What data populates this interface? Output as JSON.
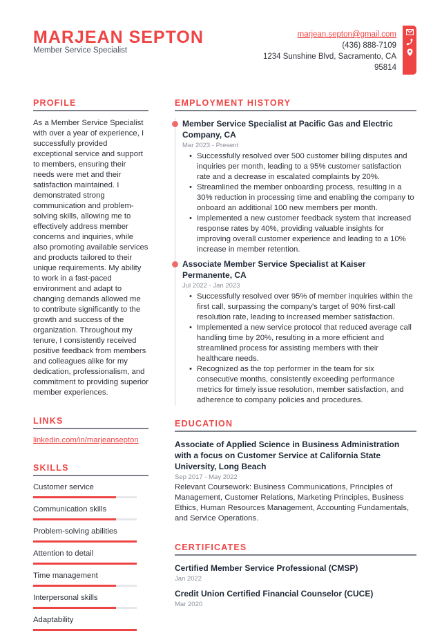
{
  "header": {
    "name": "MARJEAN SEPTON",
    "title": "Member Service Specialist",
    "email": "marjean.septon@gmail.com",
    "phone": "(436) 888-7109",
    "address_line1": "1234 Sunshine Blvd, Sacramento, CA",
    "address_line2": "95814",
    "icons": [
      "envelope-icon",
      "phone-icon",
      "map-pin-icon"
    ]
  },
  "accent_color": "#ef4444",
  "profile": {
    "heading": "PROFILE",
    "text": "As a Member Service Specialist with over a year of experience, I successfully provided exceptional service and support to members, ensuring their needs were met and their satisfaction maintained. I demonstrated strong communication and problem-solving skills, allowing me to effectively address member concerns and inquiries, while also promoting available services and products tailored to their unique requirements. My ability to work in a fast-paced environment and adapt to changing demands allowed me to contribute significantly to the growth and success of the organization. Throughout my tenure, I consistently received positive feedback from members and colleagues alike for my dedication, professionalism, and commitment to providing superior member experiences."
  },
  "links": {
    "heading": "LINKS",
    "items": [
      "linkedin.com/in/marjeansepton"
    ]
  },
  "skills": {
    "heading": "SKILLS",
    "items": [
      {
        "name": "Customer service",
        "level": 0.8
      },
      {
        "name": "Communication skills",
        "level": 0.8
      },
      {
        "name": "Problem-solving abilities",
        "level": 1.0
      },
      {
        "name": "Attention to detail",
        "level": 1.0
      },
      {
        "name": "Time management",
        "level": 0.8
      },
      {
        "name": "Interpersonal skills",
        "level": 0.8
      },
      {
        "name": "Adaptability",
        "level": 1.0
      }
    ]
  },
  "employment": {
    "heading": "EMPLOYMENT HISTORY",
    "jobs": [
      {
        "title": "Member Service Specialist at Pacific Gas and Electric Company, CA",
        "date": "Mar 2023 - Present",
        "bullets": [
          "Successfully resolved over 500 customer billing disputes and inquiries per month, leading to a 95% customer satisfaction rate and a decrease in escalated complaints by 20%.",
          "Streamlined the member onboarding process, resulting in a 30% reduction in processing time and enabling the company to onboard an additional 100 new members per month.",
          "Implemented a new customer feedback system that increased response rates by 40%, providing valuable insights for improving overall customer experience and leading to a 10% increase in member retention."
        ]
      },
      {
        "title": "Associate Member Service Specialist at Kaiser Permanente, CA",
        "date": "Jul 2022 - Jan 2023",
        "bullets": [
          "Successfully resolved over 95% of member inquiries within the first call, surpassing the company's target of 90% first-call resolution rate, leading to increased member satisfaction.",
          "Implemented a new service protocol that reduced average call handling time by 20%, resulting in a more efficient and streamlined process for assisting members with their healthcare needs.",
          "Recognized as the top performer in the team for six consecutive months, consistently exceeding performance metrics for timely issue resolution, member satisfaction, and adherence to company policies and procedures."
        ]
      }
    ]
  },
  "education": {
    "heading": "EDUCATION",
    "items": [
      {
        "title": "Associate of Applied Science in Business Administration with a focus on Customer Service at California State University, Long Beach",
        "date": "Sep 2017 - May 2022",
        "description": "Relevant Coursework: Business Communications, Principles of Management, Customer Relations, Marketing Principles, Business Ethics, Human Resources Management, Accounting Fundamentals, and Service Operations."
      }
    ]
  },
  "certificates": {
    "heading": "CERTIFICATES",
    "items": [
      {
        "title": "Certified Member Service Professional (CMSP)",
        "date": "Jan 2022"
      },
      {
        "title": "Credit Union Certified Financial Counselor (CUCE)",
        "date": "Mar 2020"
      }
    ]
  }
}
